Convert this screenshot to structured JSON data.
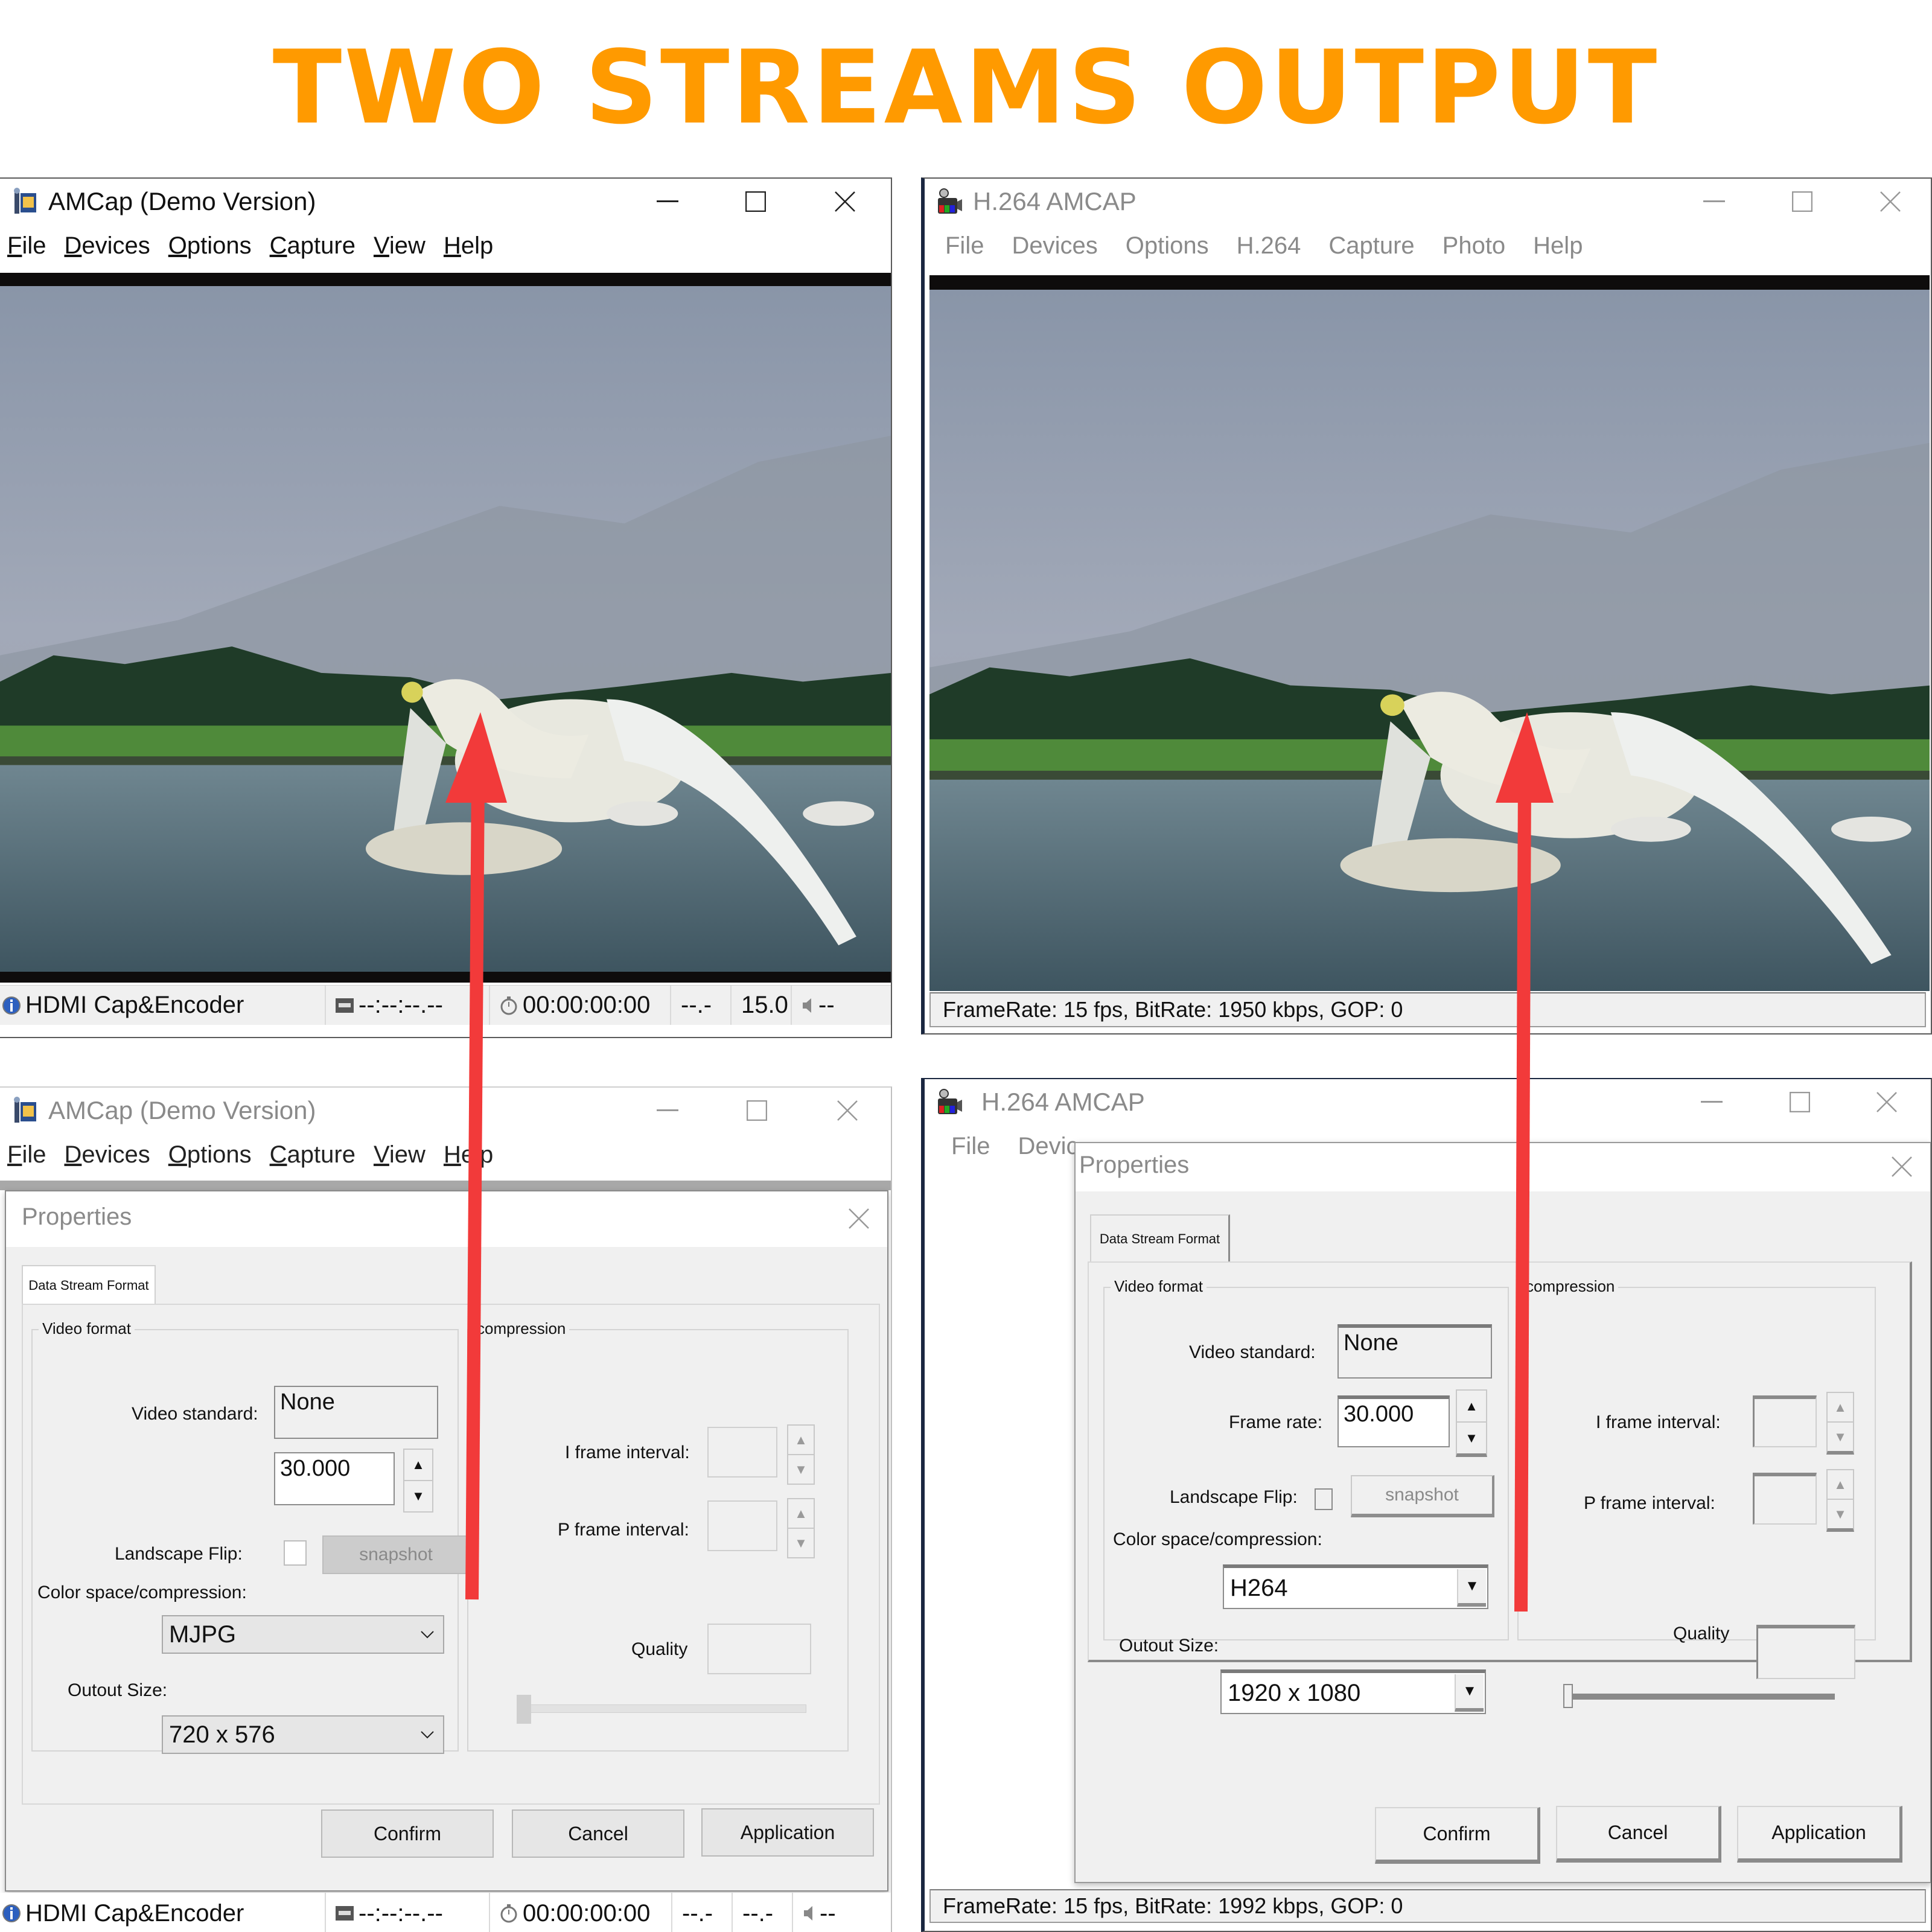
{
  "headline": "TWO STREAMS OUTPUT",
  "colors": {
    "headline": "#ff9a00",
    "arrow": "#f23a3a"
  },
  "window_top_left": {
    "title": "AMCap (Demo Version)",
    "menu": [
      {
        "label": "File",
        "accel": "F",
        "rest": "ile"
      },
      {
        "label": "Devices",
        "accel": "D",
        "rest": "evices"
      },
      {
        "label": "Options",
        "accel": "O",
        "rest": "ptions"
      },
      {
        "label": "Capture",
        "accel": "C",
        "rest": "apture"
      },
      {
        "label": "View",
        "accel": "V",
        "rest": "iew"
      },
      {
        "label": "Help",
        "accel": "H",
        "rest": "elp"
      }
    ],
    "status": {
      "device": "HDMI Cap&Encoder",
      "timecode": "--:--:--.--",
      "elapsed": "00:00:00:00",
      "value1": "--.-",
      "fps": "15.0",
      "audio": "--"
    }
  },
  "window_top_right": {
    "title": "H.264 AMCAP",
    "menu": [
      "File",
      "Devices",
      "Options",
      "H.264",
      "Capture",
      "Photo",
      "Help"
    ],
    "status": "FrameRate: 15 fps, BitRate: 1950 kbps, GOP: 0"
  },
  "window_bottom_left": {
    "title": "AMCap (Demo Version)",
    "menu": [
      {
        "label": "File",
        "accel": "F",
        "rest": "ile"
      },
      {
        "label": "Devices",
        "accel": "D",
        "rest": "evices"
      },
      {
        "label": "Options",
        "accel": "O",
        "rest": "ptions"
      },
      {
        "label": "Capture",
        "accel": "C",
        "rest": "apture"
      },
      {
        "label": "View",
        "accel": "V",
        "rest": "iew"
      },
      {
        "label": "Help",
        "accel": "H",
        "rest": "elp"
      }
    ],
    "status": {
      "device": "HDMI Cap&Encoder",
      "timecode": "--:--:--.--",
      "elapsed": "00:00:00:00",
      "value1": "--.-",
      "value2": "--.-",
      "audio": "--"
    },
    "dialog": {
      "title": "Properties",
      "tab": "Data Stream Format",
      "video_format_group": "Video format",
      "compression_group": "compression",
      "video_standard_label": "Video standard:",
      "video_standard_value": "None",
      "frame_rate_value": "30.000",
      "landscape_flip_label": "Landscape Flip:",
      "landscape_flip_checked": false,
      "snapshot_button": "snapshot",
      "color_space_label": "Color space/compression:",
      "color_space_value": "MJPG",
      "output_size_label": "Outout Size:",
      "output_size_value": "720 x 576",
      "i_frame_label": "I frame interval:",
      "p_frame_label": "P frame interval:",
      "quality_label": "Quality",
      "quality_slider_value": 0,
      "buttons": {
        "confirm": "Confirm",
        "cancel": "Cancel",
        "apply": "Application"
      }
    }
  },
  "window_bottom_right": {
    "title": "H.264 AMCAP",
    "menu_visible": [
      "File",
      "Devic"
    ],
    "status": "FrameRate: 15 fps, BitRate: 1992 kbps, GOP: 0",
    "dialog": {
      "title": "Properties",
      "tab": "Data Stream Format",
      "video_format_group": "Video format",
      "compression_group": "compression",
      "video_standard_label": "Video standard:",
      "video_standard_value": "None",
      "frame_rate_label": "Frame rate:",
      "frame_rate_value": "30.000",
      "landscape_flip_label": "Landscape Flip:",
      "landscape_flip_checked": false,
      "snapshot_button": "snapshot",
      "color_space_label": "Color space/compression:",
      "color_space_value": "H264",
      "output_size_label": "Outout Size:",
      "output_size_value": "1920 x 1080",
      "i_frame_label": "I frame interval:",
      "p_frame_label": "P frame interval:",
      "quality_label": "Quality",
      "quality_slider_value": 0,
      "buttons": {
        "confirm": "Confirm",
        "cancel": "Cancel",
        "apply": "Application"
      }
    }
  }
}
